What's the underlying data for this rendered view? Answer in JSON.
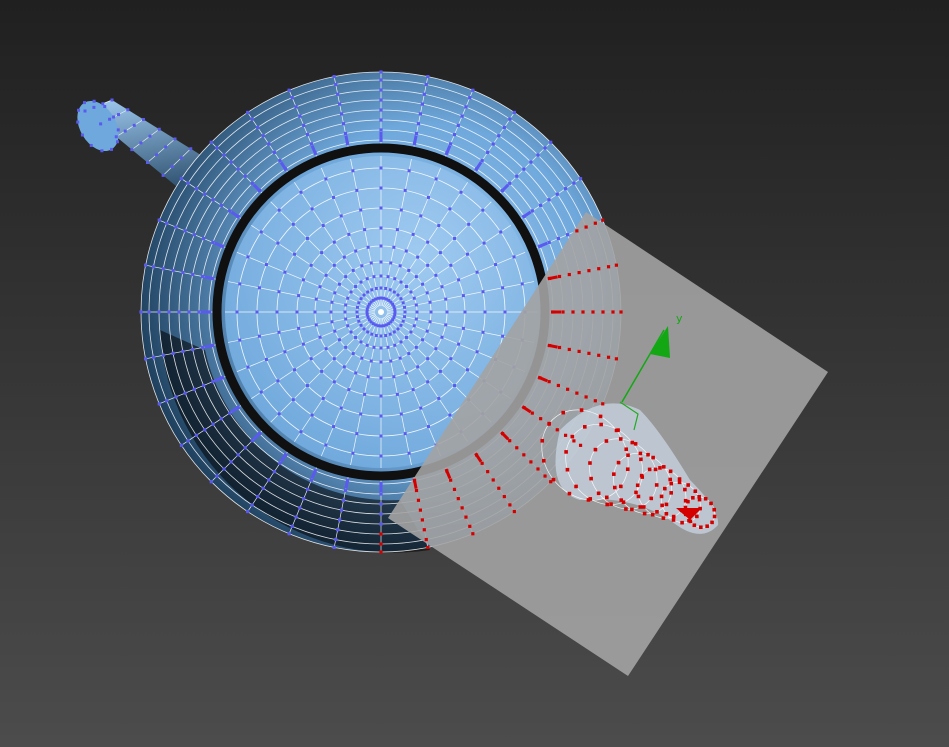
{
  "viewport": {
    "background_top": "#202020",
    "background_bottom": "#4c4c4c"
  },
  "teapot": {
    "body_color": "#6fa8dc",
    "body_light": "#9fcaf0",
    "body_dark": "#1c3d5a",
    "wire_color": "#ffffff",
    "vertex_color": "#5a5af0",
    "rim_color": "#101010"
  },
  "slice_plane": {
    "color": "#a3a3a3",
    "selected_vertex_color": "#d40000"
  },
  "gizmo": {
    "y_axis_label": "y",
    "y_axis_color": "#13a813",
    "origin_color": "#22aa22"
  }
}
